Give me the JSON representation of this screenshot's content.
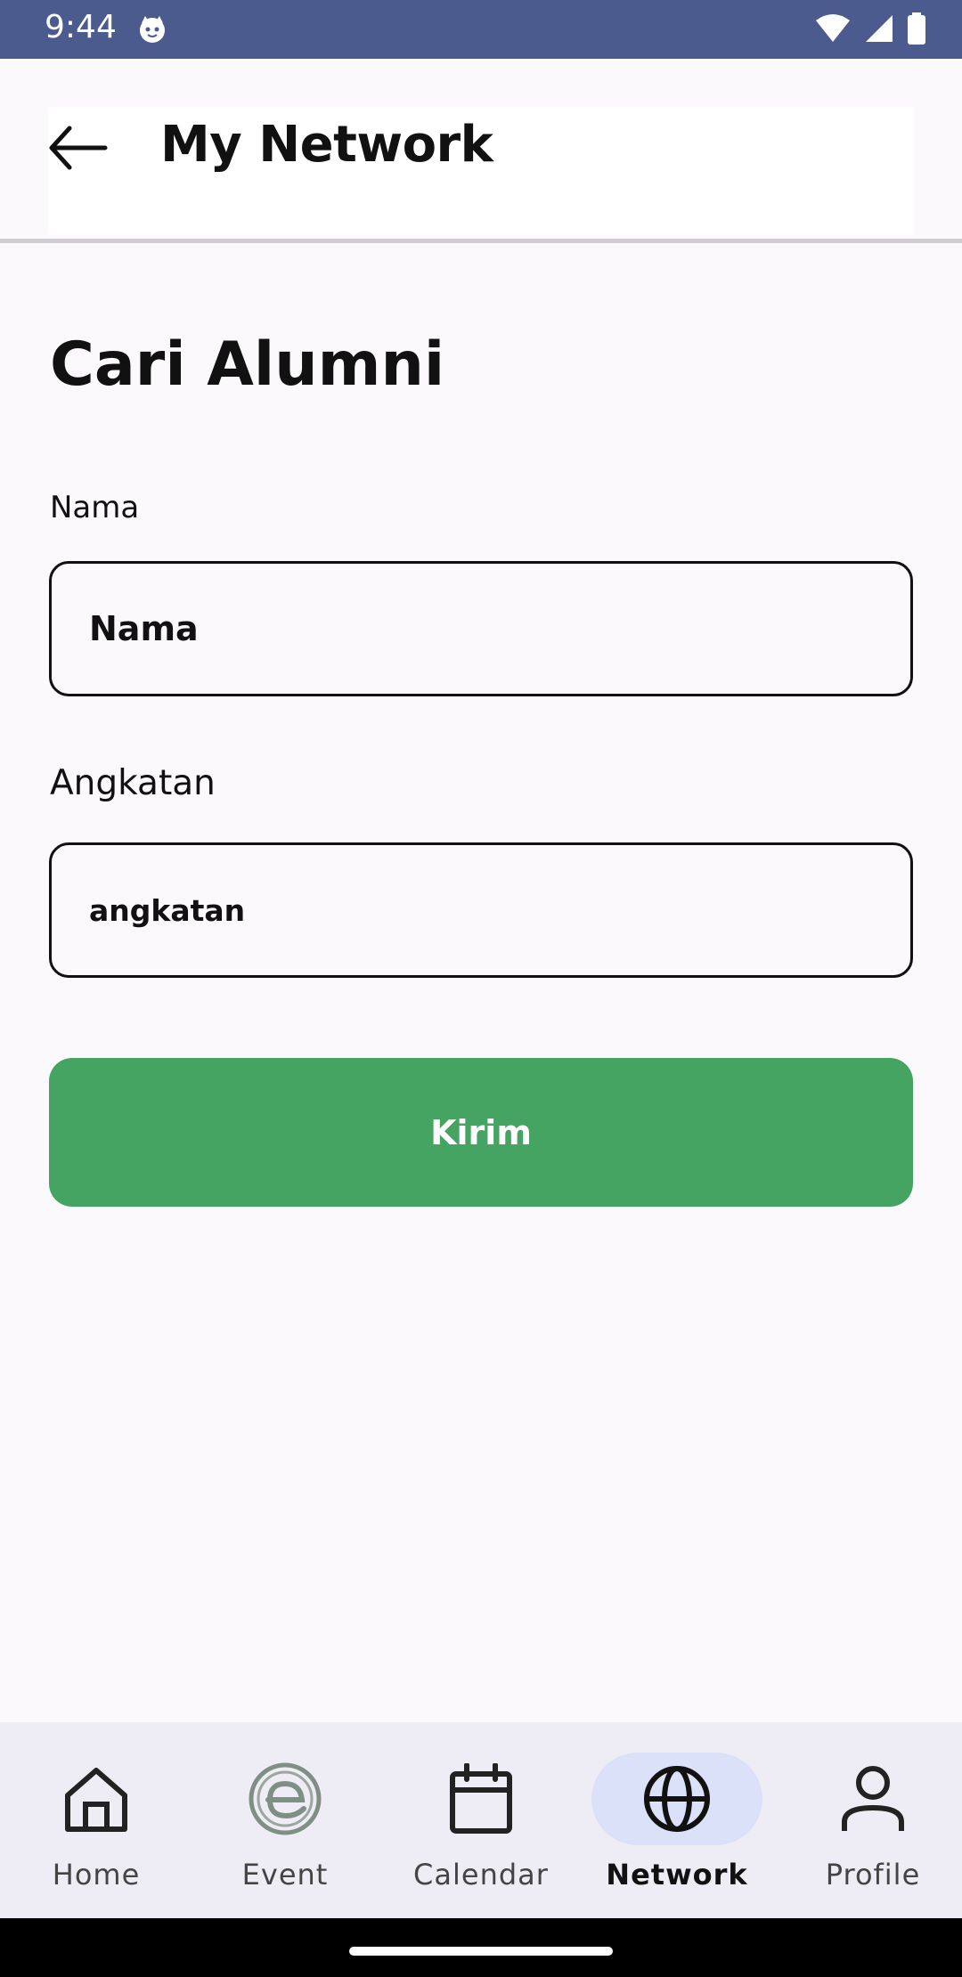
{
  "status_bar": {
    "time": "9:44",
    "bg_color": "#4b5b8d",
    "icons": [
      "cat-notification-icon",
      "wifi-icon",
      "signal-icon",
      "battery-icon"
    ]
  },
  "app_bar": {
    "title": "My Network",
    "back_icon": "arrow-back-icon"
  },
  "page": {
    "heading": "Cari Alumni"
  },
  "form": {
    "nama": {
      "label": "Nama",
      "value": "Nama"
    },
    "angkatan": {
      "label": "Angkatan",
      "value": "angkatan"
    },
    "submit_label": "Kirim",
    "submit_color": "#46a463"
  },
  "bottom_nav": {
    "items": [
      {
        "label": "Home",
        "icon": "home-icon"
      },
      {
        "label": "Event",
        "icon": "event-icon"
      },
      {
        "label": "Calendar",
        "icon": "calendar-icon"
      },
      {
        "label": "Network",
        "icon": "globe-icon",
        "active": true
      },
      {
        "label": "Profile",
        "icon": "person-icon"
      }
    ],
    "active_pill_color": "#dbe1f8"
  }
}
